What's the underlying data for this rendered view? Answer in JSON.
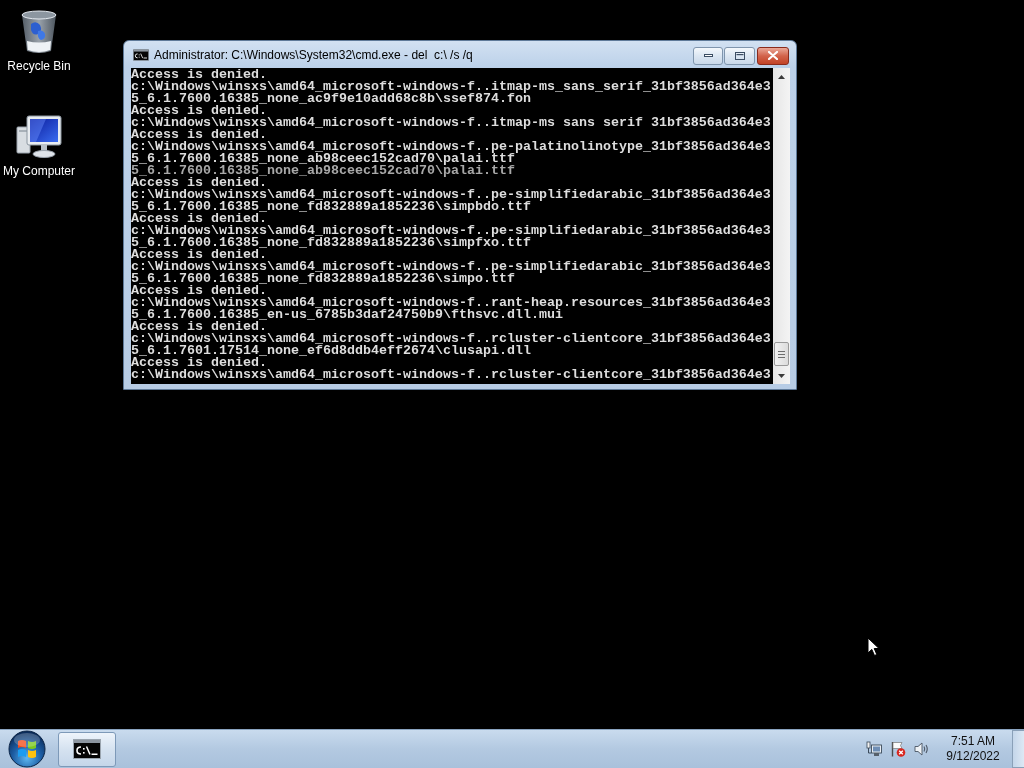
{
  "desktop": {
    "icons": [
      {
        "kind": "recycle-bin",
        "label": "Recycle Bin"
      },
      {
        "kind": "computer",
        "label": "My Computer"
      }
    ]
  },
  "window": {
    "title": "Administrator: C:\\Windows\\System32\\cmd.exe - del  c:\\ /s /q",
    "console": {
      "lines": [
        {
          "kind": "text",
          "text": "Access is denied."
        },
        {
          "kind": "text",
          "text": "c:\\Windows\\winsxs\\amd64_microsoft-windows-f..itmap-ms_sans_serif_31bf3856ad364e3"
        },
        {
          "kind": "text",
          "text": "5_6.1.7600.16385_none_ac9f9e10add68c8b\\ssef874.fon"
        },
        {
          "kind": "text",
          "text": "Access is denied."
        },
        {
          "kind": "text",
          "text": "c:\\Windows\\winsxs\\amd64_microsoft-windows-f..itmap-ms sans serif 31bf3856ad364e3"
        },
        {
          "kind": "text",
          "text": "Access is denied."
        },
        {
          "kind": "text",
          "text": "c:\\Windows\\winsxs\\amd64_microsoft-windows-f..pe-palatinolinotype_31bf3856ad364e3"
        },
        {
          "kind": "text",
          "text": "5_6.1.7600.16385_none_ab98ceec152cad70\\palai.ttf"
        },
        {
          "kind": "overdrawn",
          "text": "5_6.1.7600.16385_none_ab98ceec152cad70\\palai.ttf"
        },
        {
          "kind": "text",
          "text": "Access is denied."
        },
        {
          "kind": "text",
          "text": "c:\\Windows\\winsxs\\amd64_microsoft-windows-f..pe-simplifiedarabic_31bf3856ad364e3"
        },
        {
          "kind": "text",
          "text": "5_6.1.7600.16385_none_fd832889a1852236\\simpbdo.ttf"
        },
        {
          "kind": "text",
          "text": "Access is denied."
        },
        {
          "kind": "text",
          "text": "c:\\Windows\\winsxs\\amd64_microsoft-windows-f..pe-simplifiedarabic_31bf3856ad364e3"
        },
        {
          "kind": "text",
          "text": "5_6.1.7600.16385_none_fd832889a1852236\\simpfxo.ttf"
        },
        {
          "kind": "text",
          "text": "Access is denied."
        },
        {
          "kind": "text",
          "text": "c:\\Windows\\winsxs\\amd64_microsoft-windows-f..pe-simplifiedarabic_31bf3856ad364e3"
        },
        {
          "kind": "text",
          "text": "5_6.1.7600.16385_none_fd832889a1852236\\simpo.ttf"
        },
        {
          "kind": "text",
          "text": "Access is denied."
        },
        {
          "kind": "text",
          "text": "c:\\Windows\\winsxs\\amd64_microsoft-windows-f..rant-heap.resources_31bf3856ad364e3"
        },
        {
          "kind": "text",
          "text": "5_6.1.7600.16385_en-us_6785b3daf24750b9\\fthsvc.dll.mui"
        },
        {
          "kind": "text",
          "text": "Access is denied."
        },
        {
          "kind": "text",
          "text": "c:\\Windows\\winsxs\\amd64_microsoft-windows-f..rcluster-clientcore_31bf3856ad364e3"
        },
        {
          "kind": "text",
          "text": "5_6.1.7601.17514_none_ef6d8ddb4eff2674\\clusapi.dll"
        },
        {
          "kind": "text",
          "text": "Access is denied."
        },
        {
          "kind": "text",
          "text": "c:\\Windows\\winsxs\\amd64_microsoft-windows-f..rcluster-clientcore_31bf3856ad364e3"
        }
      ]
    }
  },
  "taskbar": {
    "apps": [
      {
        "kind": "console",
        "selected": true
      }
    ],
    "clock": {
      "time": "7:51 AM",
      "date": "9/12/2022"
    }
  }
}
